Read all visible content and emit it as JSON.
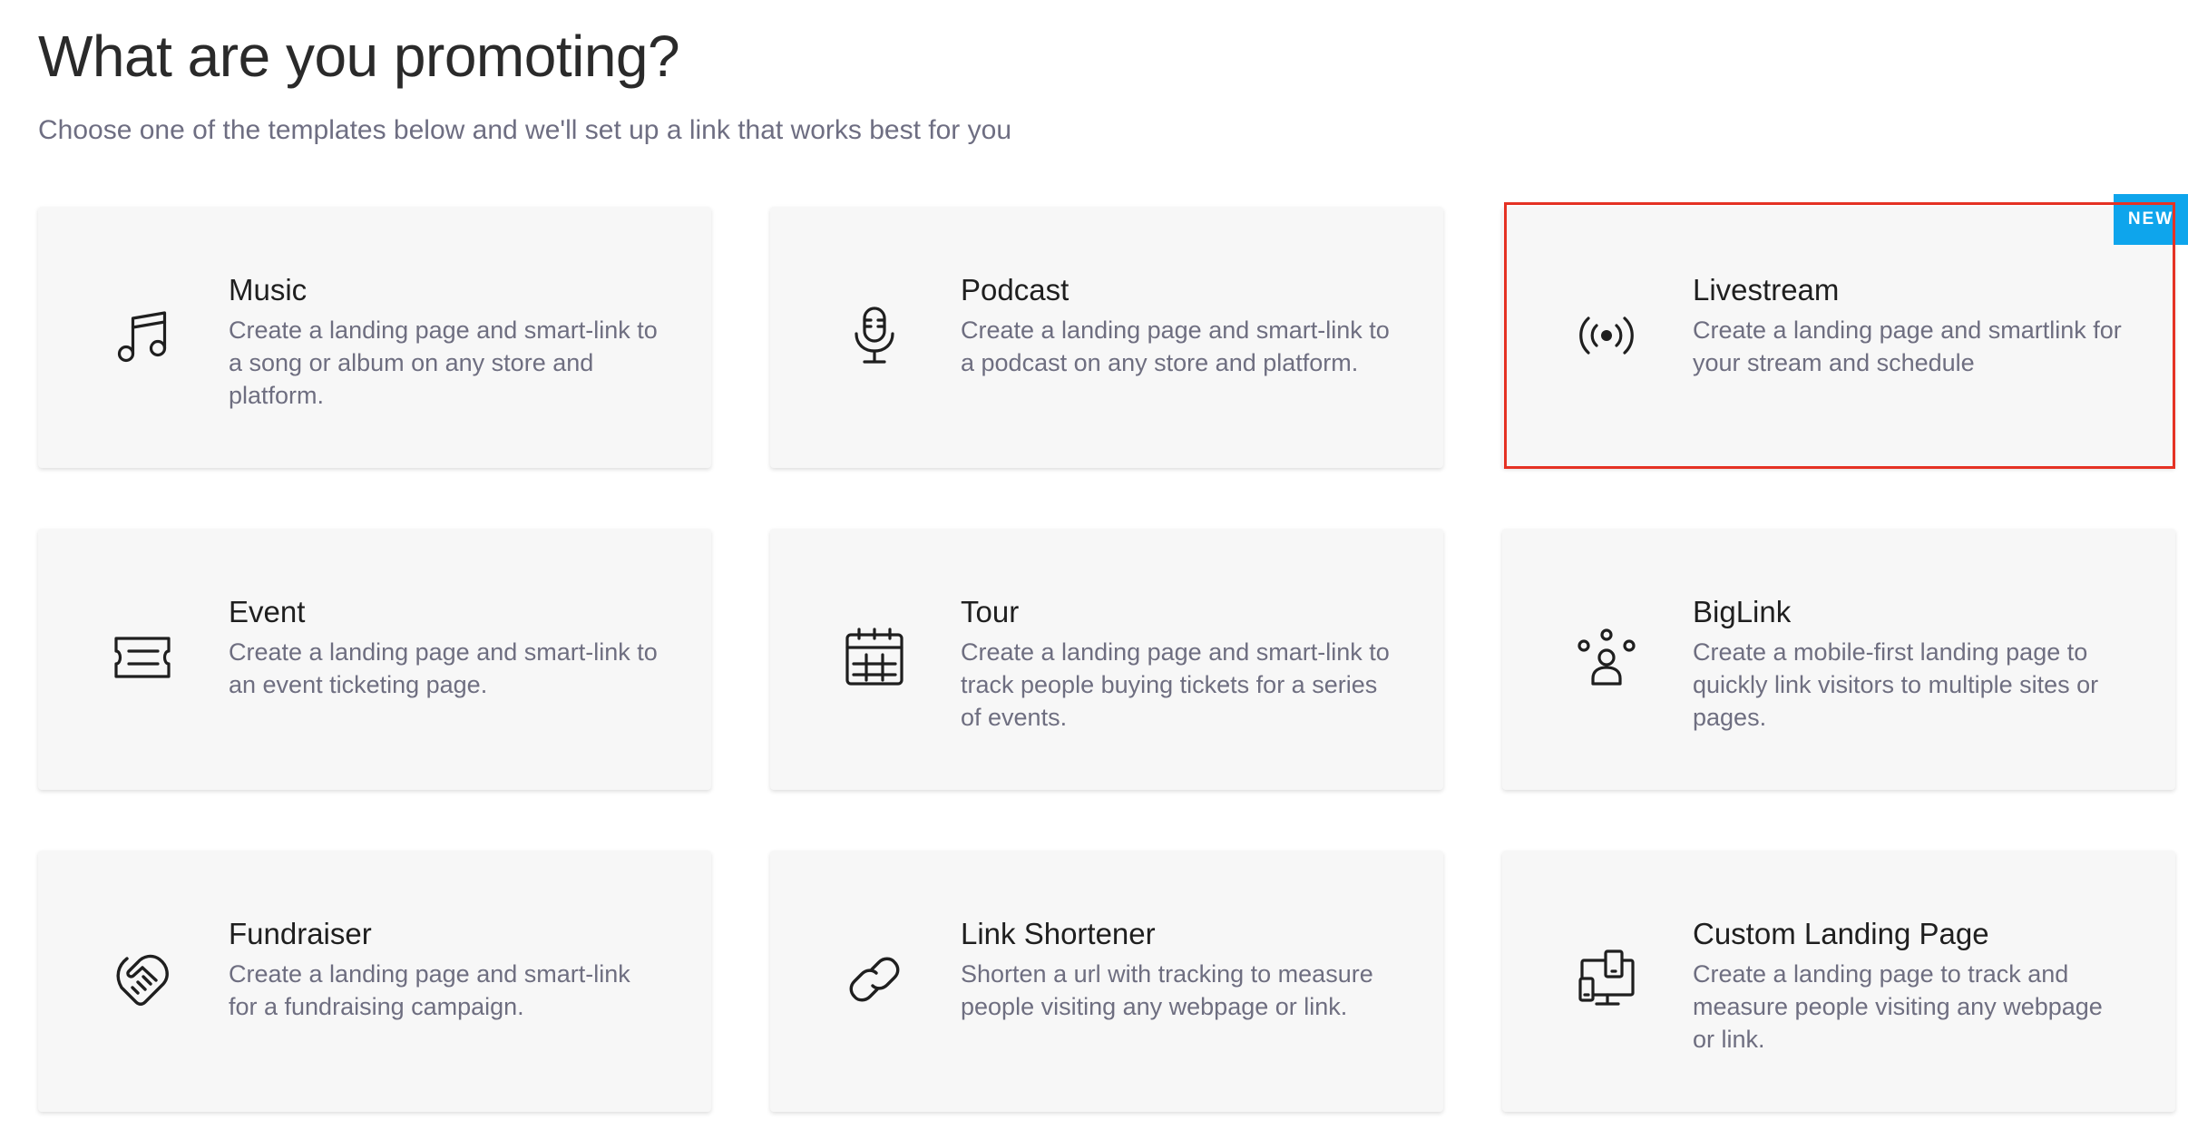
{
  "header": {
    "title": "What are you promoting?",
    "subtitle": "Choose one of the templates below and we'll set up a link that works best for you"
  },
  "templates": [
    {
      "title": "Music",
      "description": "Create a landing page and smart-link to a song or album on any store and platform.",
      "icon": "music-note-icon"
    },
    {
      "title": "Podcast",
      "description": "Create a landing page and smart-link to a podcast on any store and platform.",
      "icon": "microphone-icon"
    },
    {
      "title": "Livestream",
      "description": "Create a landing page and smartlink for your stream and schedule",
      "icon": "broadcast-icon",
      "badge": "NEW"
    },
    {
      "title": "Event",
      "description": "Create a landing page and smart-link to an event ticketing page.",
      "icon": "ticket-icon"
    },
    {
      "title": "Tour",
      "description": "Create a landing page and smart-link to track people buying tickets for a series of events.",
      "icon": "calendar-icon"
    },
    {
      "title": "BigLink",
      "description": "Create a mobile-first landing page to quickly link visitors to multiple sites or pages.",
      "icon": "people-icon"
    },
    {
      "title": "Fundraiser",
      "description": "Create a landing page and smart-link for a fundraising campaign.",
      "icon": "handshake-icon"
    },
    {
      "title": "Link Shortener",
      "description": "Shorten a url with tracking to measure people visiting any webpage or link.",
      "icon": "link-icon"
    },
    {
      "title": "Custom Landing Page",
      "description": "Create a landing page to track and measure people visiting any webpage or link.",
      "icon": "devices-icon"
    }
  ],
  "colors": {
    "badge": "#0ea5ec",
    "highlight": "#e53224",
    "card_background": "#f7f7f7",
    "description_text": "#6e6e80"
  }
}
